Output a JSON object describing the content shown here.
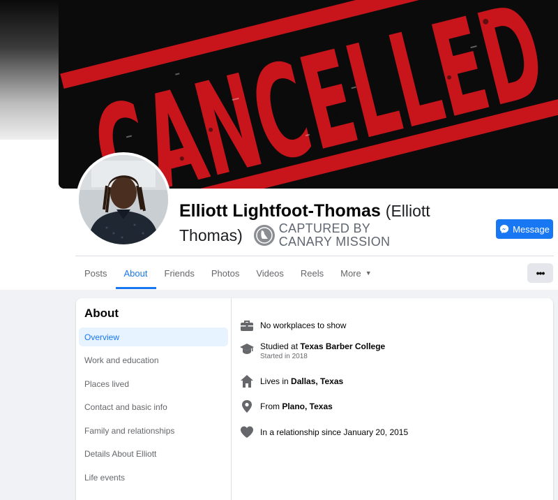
{
  "cover": {
    "text": "CANCELLED"
  },
  "profile": {
    "name": "Elliott Lightfoot-Thomas",
    "alt_name_part1": "(Elliott",
    "alt_name_part2": "Thomas)",
    "watermark_line1": "CAPTURED BY",
    "watermark_line2": "CANARY MISSION",
    "message_label": "Message"
  },
  "tabs": [
    {
      "label": "Posts"
    },
    {
      "label": "About",
      "active": true
    },
    {
      "label": "Friends"
    },
    {
      "label": "Photos"
    },
    {
      "label": "Videos"
    },
    {
      "label": "Reels"
    },
    {
      "label": "More"
    }
  ],
  "more_dots": "•••",
  "about": {
    "title": "About",
    "nav": [
      {
        "label": "Overview",
        "active": true
      },
      {
        "label": "Work and education"
      },
      {
        "label": "Places lived"
      },
      {
        "label": "Contact and basic info"
      },
      {
        "label": "Family and relationships"
      },
      {
        "label": "Details About Elliott"
      },
      {
        "label": "Life events"
      }
    ],
    "work": {
      "text": "No workplaces to show"
    },
    "education": {
      "prefix": "Studied at ",
      "school": "Texas Barber College",
      "sub": "Started in 2018"
    },
    "lives": {
      "prefix": "Lives in ",
      "place": "Dallas, Texas"
    },
    "from": {
      "prefix": "From ",
      "place": "Plano, Texas"
    },
    "relationship": {
      "text": "In a relationship since January 20, 2015"
    }
  },
  "colors": {
    "accent": "#1877f2",
    "cover_red": "#c8141b",
    "icon_gray": "#65676b"
  }
}
